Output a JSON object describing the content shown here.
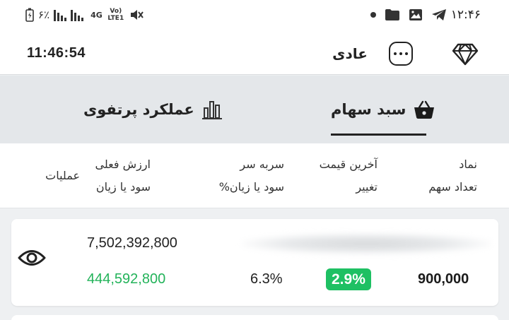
{
  "status_bar": {
    "time": "۱۲:۴۶",
    "battery_percent": "۶٪",
    "network_label": "4G",
    "volte_label": "Vo) LTE1",
    "icons": [
      "dot-icon",
      "folder-icon",
      "image-icon",
      "telegram-icon",
      "mute-icon",
      "signal-icon",
      "battery-icon"
    ]
  },
  "header": {
    "clock": "11:46:54",
    "mode_label": "عادی",
    "more_icon": "more-dots-icon",
    "premium_icon": "diamond-icon"
  },
  "tabs": [
    {
      "label": "سبد سهام",
      "icon": "basket-icon",
      "active": true
    },
    {
      "label": "عملکرد پرتفوی",
      "icon": "bar-chart-icon",
      "active": false
    }
  ],
  "columns": {
    "symbol": "نماد",
    "share_count": "تعداد سهم",
    "last_price": "آخرین قیمت",
    "change": "تغییر",
    "breakeven": "سربه سر",
    "pnl_percent": "%سود یا زیان",
    "current_value": "ارزش فعلی",
    "pnl": "سود یا زیان",
    "actions": "عملیات"
  },
  "holdings": [
    {
      "share_count": "900,000",
      "change_percent": "2.9%",
      "pnl_percent": "6.3%",
      "current_value": "7,502,392,800",
      "pnl": "444,592,800",
      "action_icon": "eye-icon"
    }
  ],
  "colors": {
    "profit_green": "#23b35a",
    "badge_green": "#1ec063",
    "tab_bar_bg": "#e4e7ea"
  }
}
